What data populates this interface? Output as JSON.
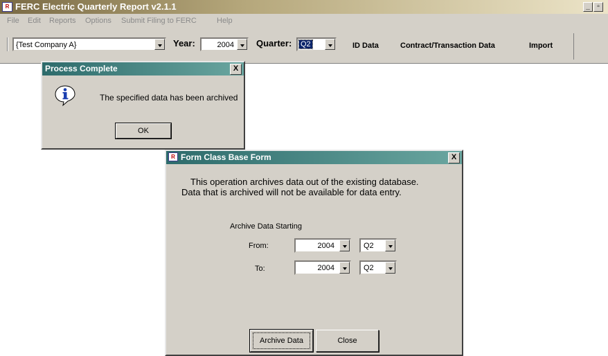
{
  "app": {
    "title": "FERC Electric Quarterly Report v2.1.1",
    "min_label": "_",
    "max_label": "▫"
  },
  "menu": {
    "file": "File",
    "edit": "Edit",
    "reports": "Reports",
    "options": "Options",
    "submit": "Submit Filing to FERC",
    "help": "Help"
  },
  "toolbar": {
    "company": "{Test Company A}",
    "year_label": "Year:",
    "year_value": "2004",
    "quarter_label": "Quarter:",
    "quarter_value": "Q2",
    "id_data": "ID Data",
    "contract_data": "Contract/Transaction Data",
    "import": "Import"
  },
  "process_dialog": {
    "title": "Process Complete",
    "message": "The specified data has been archived",
    "ok": "OK",
    "close_label": "X"
  },
  "archive_dialog": {
    "title": "Form Class Base Form",
    "line1": "This operation archives data out of the existing database.",
    "line2": "Data that is archived will not be available for data entry.",
    "section_label": "Archive Data Starting",
    "from_label": "From:",
    "to_label": "To:",
    "from_year": "2004",
    "from_quarter": "Q2",
    "to_year": "2004",
    "to_quarter": "Q2",
    "archive_button": "Archive Data",
    "close_button": "Close",
    "close_label": "X"
  }
}
